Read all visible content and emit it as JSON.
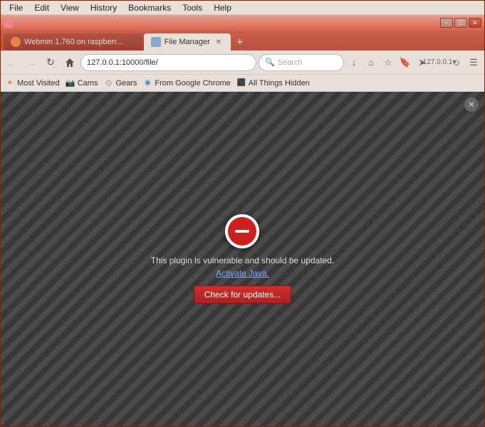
{
  "window": {
    "title": "File Manager",
    "controls": {
      "minimize": "−",
      "maximize": "□",
      "close": "✕"
    }
  },
  "menu": {
    "items": [
      "File",
      "Edit",
      "View",
      "History",
      "Bookmarks",
      "Tools",
      "Help"
    ]
  },
  "tabs": [
    {
      "label": "Webmin 1.760 on raspberr...",
      "active": false,
      "icon_color": "#e8844a"
    },
    {
      "label": "File Manager",
      "active": true,
      "icon_color": "#88aacc"
    }
  ],
  "nav": {
    "address": "127.0.0.1:10000/file/",
    "search_placeholder": "Search",
    "back_disabled": true,
    "forward_disabled": true,
    "ip_label": "127.0.0.1▾"
  },
  "bookmarks": [
    {
      "label": "Most Visited",
      "icon": "★",
      "icon_color": "#e8844a"
    },
    {
      "label": "Cams",
      "icon": "📷",
      "icon_color": "#cc6644"
    },
    {
      "label": "Gears",
      "icon": "⚙",
      "icon_color": "#aaaaaa"
    },
    {
      "label": "From Google Chrome",
      "icon": "◉",
      "icon_color": "#4488cc"
    },
    {
      "label": "All Things Hidden",
      "icon": "⬛",
      "icon_color": "#444444"
    }
  ],
  "plugin_error": {
    "message": "This plugin is vulnerable and should be updated.",
    "activate_link": "Activate Java.",
    "button_label": "Check for updates..."
  },
  "content_close": "✕"
}
